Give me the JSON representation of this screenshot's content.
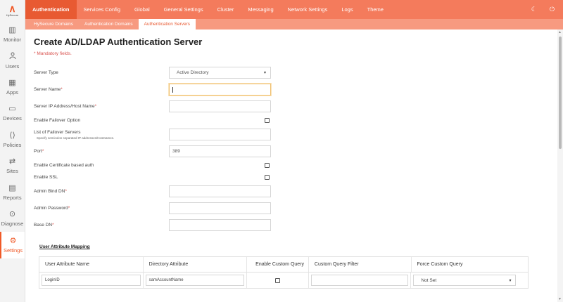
{
  "brand": {
    "name": "HySecure"
  },
  "sidebar": {
    "items": [
      {
        "label": "Monitor",
        "icon": "monitor-icon",
        "glyph": "▥"
      },
      {
        "label": "Users",
        "icon": "users-icon",
        "glyph": "👤"
      },
      {
        "label": "Apps",
        "icon": "apps-icon",
        "glyph": "▦"
      },
      {
        "label": "Devices",
        "icon": "devices-icon",
        "glyph": "▭"
      },
      {
        "label": "Policies",
        "icon": "policies-icon",
        "glyph": "⟨⟩"
      },
      {
        "label": "Sites",
        "icon": "sites-icon",
        "glyph": "⇄"
      },
      {
        "label": "Reports",
        "icon": "reports-icon",
        "glyph": "▤"
      },
      {
        "label": "Diagnose",
        "icon": "diagnose-icon",
        "glyph": "⊙"
      },
      {
        "label": "Settings",
        "icon": "settings-icon",
        "glyph": "⚙"
      }
    ],
    "active": "Settings"
  },
  "topnav": {
    "tabs": [
      "Authentication",
      "Services Config",
      "Global",
      "General Settings",
      "Cluster",
      "Messaging",
      "Network Settings",
      "Logs",
      "Theme"
    ],
    "active": "Authentication"
  },
  "subnav": {
    "tabs": [
      "HySecure Domains",
      "Authentication Domains",
      "Authentication Servers"
    ],
    "active": "Authentication Servers"
  },
  "page": {
    "title": "Create AD/LDAP Authentication Server",
    "mandatory_note": "* Mandatory fields."
  },
  "form": {
    "server_type": {
      "label": "Server Type",
      "value": "Active Directory"
    },
    "server_name": {
      "label": "Server Name",
      "value": ""
    },
    "server_ip": {
      "label": "Server IP Address/Host Name",
      "value": ""
    },
    "failover_option": {
      "label": "Enable Failover Option"
    },
    "failover_servers": {
      "label": "List of Failover Servers",
      "hint": "Specify semicolon separated IP addresses/Hostnames.",
      "value": ""
    },
    "port": {
      "label": "Port",
      "value": "389"
    },
    "cert_auth": {
      "label": "Enable Certificate based auth"
    },
    "ssl": {
      "label": "Enable SSL"
    },
    "admin_bind_dn": {
      "label": "Admin Bind DN",
      "value": ""
    },
    "admin_password": {
      "label": "Admin Password",
      "value": ""
    },
    "base_dn": {
      "label": "Base DN",
      "value": ""
    },
    "required_star": "*"
  },
  "mapping": {
    "title": "User Attribute Mapping",
    "columns": [
      "User Attribute Name",
      "Directory Attribute",
      "Enable Custom Query",
      "Custom Query Filter",
      "Force Custom Query"
    ],
    "rows": [
      {
        "attribute": "LoginID",
        "directory": "samAccountName",
        "filter": "",
        "force": "Not Set"
      }
    ]
  },
  "colors": {
    "accent": "#f47b5c",
    "accent_dark": "#e85a32",
    "required": "#d9534f"
  }
}
